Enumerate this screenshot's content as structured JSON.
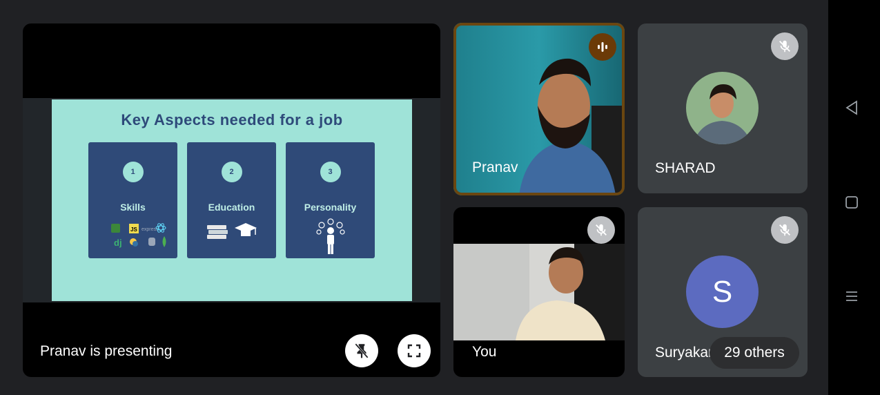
{
  "presentation": {
    "status_text": "Pranav is presenting",
    "slide": {
      "title": "Key Aspects needed for a job",
      "cards": [
        {
          "number": "1",
          "label": "Skills",
          "art": "tech-logos-icon"
        },
        {
          "number": "2",
          "label": "Education",
          "art": "books-graduation-icon"
        },
        {
          "number": "3",
          "label": "Personality",
          "art": "person-thinking-icon"
        }
      ],
      "skill_logo_text": [
        "JS",
        "express",
        "dj"
      ]
    },
    "unpin_icon": "pin-off-icon",
    "fullscreen_icon": "fullscreen-icon"
  },
  "participants": {
    "speaker": {
      "name": "Pranav",
      "indicator": "audio-level-icon"
    },
    "self": {
      "name": "You",
      "indicator": "mic-off-icon"
    },
    "sharad": {
      "name": "SHARAD",
      "indicator": "mic-off-icon"
    },
    "others": {
      "name": "Suryakant",
      "overflow_label": "29 others",
      "avatar_letter": "S",
      "indicator": "mic-off-icon"
    }
  },
  "navigation": {
    "back": "back-icon",
    "home": "home-icon",
    "recents": "recents-icon"
  },
  "colors": {
    "speaker_frame": "#6b4610",
    "avatar_letter_bg": "#5c6bc0",
    "slide_bg": "#9fe3d8",
    "card_bg": "#2f4a78"
  }
}
